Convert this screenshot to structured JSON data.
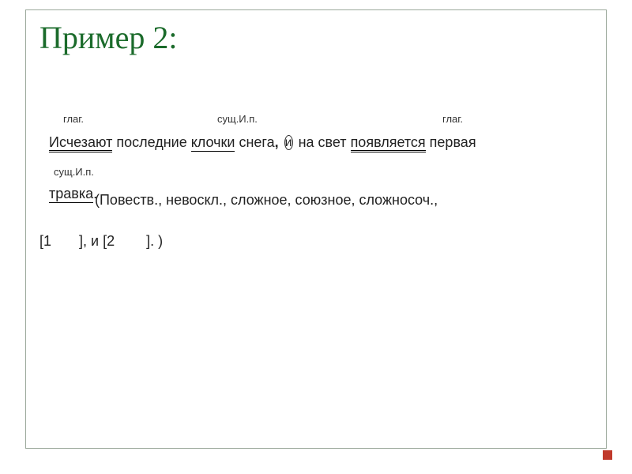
{
  "title": "Пример 2:",
  "labels": {
    "l1": "глаг.",
    "l2": "сущ.И.п.",
    "l3": "глаг.",
    "l4": "сущ.И.п."
  },
  "sentence": {
    "w1": "Исчезают",
    "w2": " последние ",
    "w3": "клочки",
    "w4": " снега",
    "comma": ",",
    "space1": " ",
    "conj": "и",
    "space2": " ",
    "w5": "на свет ",
    "w6": "появляется",
    "w7": " первая"
  },
  "line2": {
    "w8": "травка",
    "dot": "."
  },
  "characteristics": "(Повеств., невоскл., сложное, союзное,   сложносоч.,",
  "scheme": "[1       ], и [2        ]. )"
}
